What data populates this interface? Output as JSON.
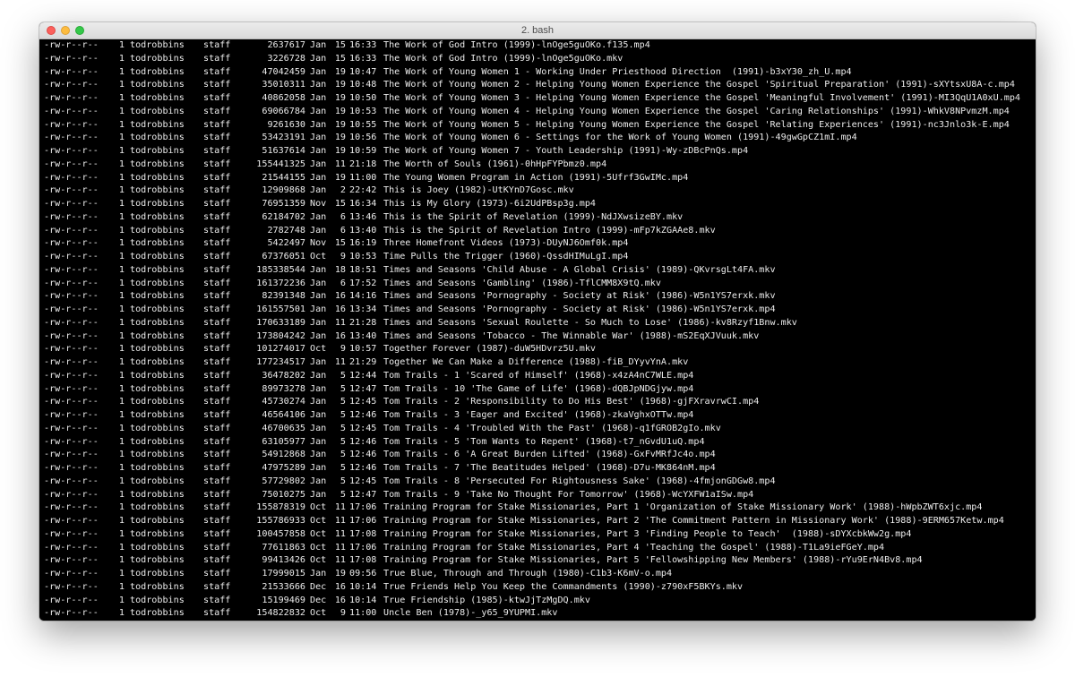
{
  "window": {
    "title": "2. bash"
  },
  "colors": {
    "terminal_bg": "#000000",
    "terminal_fg": "#ececec",
    "close": "#fc605c",
    "minimize": "#fdbc40",
    "maximize": "#34c84a"
  },
  "listing": [
    {
      "perm": "-rw-r--r--",
      "links": "1",
      "owner": "todrobbins",
      "group": "staff",
      "size": "2637617",
      "month": "Jan",
      "day": "15",
      "time": "16:33",
      "name": "The Work of God Intro (1999)-lnOge5guOKo.f135.mp4"
    },
    {
      "perm": "-rw-r--r--",
      "links": "1",
      "owner": "todrobbins",
      "group": "staff",
      "size": "3226728",
      "month": "Jan",
      "day": "15",
      "time": "16:33",
      "name": "The Work of God Intro (1999)-lnOge5guOKo.mkv"
    },
    {
      "perm": "-rw-r--r--",
      "links": "1",
      "owner": "todrobbins",
      "group": "staff",
      "size": "47042459",
      "month": "Jan",
      "day": "19",
      "time": "10:47",
      "name": "The Work of Young Women 1 - Working Under Priesthood Direction  (1991)-b3xY30_zh_U.mp4"
    },
    {
      "perm": "-rw-r--r--",
      "links": "1",
      "owner": "todrobbins",
      "group": "staff",
      "size": "35010311",
      "month": "Jan",
      "day": "19",
      "time": "10:48",
      "name": "The Work of Young Women 2 - Helping Young Women Experience the Gospel 'Spiritual Preparation' (1991)-sXYtsxU8A-c.mp4"
    },
    {
      "perm": "-rw-r--r--",
      "links": "1",
      "owner": "todrobbins",
      "group": "staff",
      "size": "40862058",
      "month": "Jan",
      "day": "19",
      "time": "10:50",
      "name": "The Work of Young Women 3 - Helping Young Women Experience the Gospel 'Meaningful Involvement' (1991)-MI3QqU1A0xU.mp4"
    },
    {
      "perm": "-rw-r--r--",
      "links": "1",
      "owner": "todrobbins",
      "group": "staff",
      "size": "69066784",
      "month": "Jan",
      "day": "19",
      "time": "10:53",
      "name": "The Work of Young Women 4 - Helping Young Women Experience the Gospel 'Caring Relationships' (1991)-WhkV8NPvmzM.mp4"
    },
    {
      "perm": "-rw-r--r--",
      "links": "1",
      "owner": "todrobbins",
      "group": "staff",
      "size": "9261630",
      "month": "Jan",
      "day": "19",
      "time": "10:55",
      "name": "The Work of Young Women 5 - Helping Young Women Experience the Gospel 'Relating Experiences' (1991)-nc3Jnlo3k-E.mp4"
    },
    {
      "perm": "-rw-r--r--",
      "links": "1",
      "owner": "todrobbins",
      "group": "staff",
      "size": "53423191",
      "month": "Jan",
      "day": "19",
      "time": "10:56",
      "name": "The Work of Young Women 6 - Settings for the Work of Young Women (1991)-49gwGpCZ1mI.mp4"
    },
    {
      "perm": "-rw-r--r--",
      "links": "1",
      "owner": "todrobbins",
      "group": "staff",
      "size": "51637614",
      "month": "Jan",
      "day": "19",
      "time": "10:59",
      "name": "The Work of Young Women 7 - Youth Leadership (1991)-Wy-zDBcPnQs.mp4"
    },
    {
      "perm": "-rw-r--r--",
      "links": "1",
      "owner": "todrobbins",
      "group": "staff",
      "size": "155441325",
      "month": "Jan",
      "day": "11",
      "time": "21:18",
      "name": "The Worth of Souls (1961)-0hHpFYPbmz0.mp4"
    },
    {
      "perm": "-rw-r--r--",
      "links": "1",
      "owner": "todrobbins",
      "group": "staff",
      "size": "21544155",
      "month": "Jan",
      "day": "19",
      "time": "11:00",
      "name": "The Young Women Program in Action (1991)-5Ufrf3GwIMc.mp4"
    },
    {
      "perm": "-rw-r--r--",
      "links": "1",
      "owner": "todrobbins",
      "group": "staff",
      "size": "12909868",
      "month": "Jan",
      "day": "2",
      "time": "22:42",
      "name": "This is Joey (1982)-UtKYnD7Gosc.mkv"
    },
    {
      "perm": "-rw-r--r--",
      "links": "1",
      "owner": "todrobbins",
      "group": "staff",
      "size": "76951359",
      "month": "Nov",
      "day": "15",
      "time": "16:34",
      "name": "This is My Glory (1973)-6i2UdPBsp3g.mp4"
    },
    {
      "perm": "-rw-r--r--",
      "links": "1",
      "owner": "todrobbins",
      "group": "staff",
      "size": "62184702",
      "month": "Jan",
      "day": "6",
      "time": "13:46",
      "name": "This is the Spirit of Revelation (1999)-NdJXwsizeBY.mkv"
    },
    {
      "perm": "-rw-r--r--",
      "links": "1",
      "owner": "todrobbins",
      "group": "staff",
      "size": "2782748",
      "month": "Jan",
      "day": "6",
      "time": "13:40",
      "name": "This is the Spirit of Revelation Intro (1999)-mFp7kZGAAe8.mkv"
    },
    {
      "perm": "-rw-r--r--",
      "links": "1",
      "owner": "todrobbins",
      "group": "staff",
      "size": "5422497",
      "month": "Nov",
      "day": "15",
      "time": "16:19",
      "name": "Three Homefront Videos (1973)-DUyNJ6Omf0k.mp4"
    },
    {
      "perm": "-rw-r--r--",
      "links": "1",
      "owner": "todrobbins",
      "group": "staff",
      "size": "67376051",
      "month": "Oct",
      "day": "9",
      "time": "10:53",
      "name": "Time Pulls the Trigger (1960)-QssdHIMuLgI.mp4"
    },
    {
      "perm": "-rw-r--r--",
      "links": "1",
      "owner": "todrobbins",
      "group": "staff",
      "size": "185338544",
      "month": "Jan",
      "day": "18",
      "time": "18:51",
      "name": "Times and Seasons 'Child Abuse - A Global Crisis' (1989)-QKvrsgLt4FA.mkv"
    },
    {
      "perm": "-rw-r--r--",
      "links": "1",
      "owner": "todrobbins",
      "group": "staff",
      "size": "161372236",
      "month": "Jan",
      "day": "6",
      "time": "17:52",
      "name": "Times and Seasons 'Gambling' (1986)-TflCMM8X9tQ.mkv"
    },
    {
      "perm": "-rw-r--r--",
      "links": "1",
      "owner": "todrobbins",
      "group": "staff",
      "size": "82391348",
      "month": "Jan",
      "day": "16",
      "time": "14:16",
      "name": "Times and Seasons 'Pornography - Society at Risk' (1986)-W5n1YS7erxk.mkv"
    },
    {
      "perm": "-rw-r--r--",
      "links": "1",
      "owner": "todrobbins",
      "group": "staff",
      "size": "161557501",
      "month": "Jan",
      "day": "16",
      "time": "13:34",
      "name": "Times and Seasons 'Pornography - Society at Risk' (1986)-W5n1YS7erxk.mp4"
    },
    {
      "perm": "-rw-r--r--",
      "links": "1",
      "owner": "todrobbins",
      "group": "staff",
      "size": "170633189",
      "month": "Jan",
      "day": "11",
      "time": "21:28",
      "name": "Times and Seasons 'Sexual Roulette - So Much to Lose' (1986)-kv8Rzyf1Bnw.mkv"
    },
    {
      "perm": "-rw-r--r--",
      "links": "1",
      "owner": "todrobbins",
      "group": "staff",
      "size": "173804242",
      "month": "Jan",
      "day": "16",
      "time": "13:40",
      "name": "Times and Seasons 'Tobacco - The Winnable War' (1988)-mS2EqXJVuuk.mkv"
    },
    {
      "perm": "-rw-r--r--",
      "links": "1",
      "owner": "todrobbins",
      "group": "staff",
      "size": "101274017",
      "month": "Oct",
      "day": "9",
      "time": "10:57",
      "name": "Together Forever (1987)-duW5HDvrz5U.mkv"
    },
    {
      "perm": "-rw-r--r--",
      "links": "1",
      "owner": "todrobbins",
      "group": "staff",
      "size": "177234517",
      "month": "Jan",
      "day": "11",
      "time": "21:29",
      "name": "Together We Can Make a Difference (1988)-fiB_DYyvYnA.mkv"
    },
    {
      "perm": "-rw-r--r--",
      "links": "1",
      "owner": "todrobbins",
      "group": "staff",
      "size": "36478202",
      "month": "Jan",
      "day": "5",
      "time": "12:44",
      "name": "Tom Trails - 1 'Scared of Himself' (1968)-x4zA4nC7WLE.mp4"
    },
    {
      "perm": "-rw-r--r--",
      "links": "1",
      "owner": "todrobbins",
      "group": "staff",
      "size": "89973278",
      "month": "Jan",
      "day": "5",
      "time": "12:47",
      "name": "Tom Trails - 10 'The Game of Life' (1968)-dQBJpNDGjyw.mp4"
    },
    {
      "perm": "-rw-r--r--",
      "links": "1",
      "owner": "todrobbins",
      "group": "staff",
      "size": "45730274",
      "month": "Jan",
      "day": "5",
      "time": "12:45",
      "name": "Tom Trails - 2 'Responsibility to Do His Best' (1968)-gjFXravrwCI.mp4"
    },
    {
      "perm": "-rw-r--r--",
      "links": "1",
      "owner": "todrobbins",
      "group": "staff",
      "size": "46564106",
      "month": "Jan",
      "day": "5",
      "time": "12:46",
      "name": "Tom Trails - 3 'Eager and Excited' (1968)-zkaVghxOTTw.mp4"
    },
    {
      "perm": "-rw-r--r--",
      "links": "1",
      "owner": "todrobbins",
      "group": "staff",
      "size": "46700635",
      "month": "Jan",
      "day": "5",
      "time": "12:45",
      "name": "Tom Trails - 4 'Troubled With the Past' (1968)-q1fGROB2gIo.mkv"
    },
    {
      "perm": "-rw-r--r--",
      "links": "1",
      "owner": "todrobbins",
      "group": "staff",
      "size": "63105977",
      "month": "Jan",
      "day": "5",
      "time": "12:46",
      "name": "Tom Trails - 5 'Tom Wants to Repent' (1968)-t7_nGvdU1uQ.mp4"
    },
    {
      "perm": "-rw-r--r--",
      "links": "1",
      "owner": "todrobbins",
      "group": "staff",
      "size": "54912868",
      "month": "Jan",
      "day": "5",
      "time": "12:46",
      "name": "Tom Trails - 6 'A Great Burden Lifted' (1968)-GxFvMRfJc4o.mp4"
    },
    {
      "perm": "-rw-r--r--",
      "links": "1",
      "owner": "todrobbins",
      "group": "staff",
      "size": "47975289",
      "month": "Jan",
      "day": "5",
      "time": "12:46",
      "name": "Tom Trails - 7 'The Beatitudes Helped' (1968)-D7u-MK864nM.mp4"
    },
    {
      "perm": "-rw-r--r--",
      "links": "1",
      "owner": "todrobbins",
      "group": "staff",
      "size": "57729802",
      "month": "Jan",
      "day": "5",
      "time": "12:45",
      "name": "Tom Trails - 8 'Persecuted For Rightousness Sake' (1968)-4fmjonGDGw8.mp4"
    },
    {
      "perm": "-rw-r--r--",
      "links": "1",
      "owner": "todrobbins",
      "group": "staff",
      "size": "75010275",
      "month": "Jan",
      "day": "5",
      "time": "12:47",
      "name": "Tom Trails - 9 'Take No Thought For Tomorrow' (1968)-WcYXFW1aISw.mp4"
    },
    {
      "perm": "-rw-r--r--",
      "links": "1",
      "owner": "todrobbins",
      "group": "staff",
      "size": "155878319",
      "month": "Oct",
      "day": "11",
      "time": "17:06",
      "name": "Training Program for Stake Missionaries, Part 1 'Organization of Stake Missionary Work' (1988)-hWpbZWT6xjc.mp4"
    },
    {
      "perm": "-rw-r--r--",
      "links": "1",
      "owner": "todrobbins",
      "group": "staff",
      "size": "155786933",
      "month": "Oct",
      "day": "11",
      "time": "17:06",
      "name": "Training Program for Stake Missionaries, Part 2 'The Commitment Pattern in Missionary Work' (1988)-9ERM657Ketw.mp4"
    },
    {
      "perm": "-rw-r--r--",
      "links": "1",
      "owner": "todrobbins",
      "group": "staff",
      "size": "100457858",
      "month": "Oct",
      "day": "11",
      "time": "17:08",
      "name": "Training Program for Stake Missionaries, Part 3 'Finding People to Teach'  (1988)-sDYXcbkWw2g.mp4"
    },
    {
      "perm": "-rw-r--r--",
      "links": "1",
      "owner": "todrobbins",
      "group": "staff",
      "size": "77611863",
      "month": "Oct",
      "day": "11",
      "time": "17:06",
      "name": "Training Program for Stake Missionaries, Part 4 'Teaching the Gospel' (1988)-T1La9ieFGeY.mp4"
    },
    {
      "perm": "-rw-r--r--",
      "links": "1",
      "owner": "todrobbins",
      "group": "staff",
      "size": "99413426",
      "month": "Oct",
      "day": "11",
      "time": "17:08",
      "name": "Training Program for Stake Missionaries, Part 5 'Fellowshipping New Members' (1988)-rYu9ErN4Bv8.mp4"
    },
    {
      "perm": "-rw-r--r--",
      "links": "1",
      "owner": "todrobbins",
      "group": "staff",
      "size": "17999015",
      "month": "Jan",
      "day": "19",
      "time": "09:56",
      "name": "True Blue, Through and Through (1980)-C1b3-K6mV-o.mp4"
    },
    {
      "perm": "-rw-r--r--",
      "links": "1",
      "owner": "todrobbins",
      "group": "staff",
      "size": "21533666",
      "month": "Dec",
      "day": "16",
      "time": "10:14",
      "name": "True Friends Help You Keep the Commandments (1990)-z790xF5BKYs.mkv"
    },
    {
      "perm": "-rw-r--r--",
      "links": "1",
      "owner": "todrobbins",
      "group": "staff",
      "size": "15199469",
      "month": "Dec",
      "day": "16",
      "time": "10:14",
      "name": "True Friendship (1985)-ktwJjTzMgDQ.mkv"
    },
    {
      "perm": "-rw-r--r--",
      "links": "1",
      "owner": "todrobbins",
      "group": "staff",
      "size": "154822832",
      "month": "Oct",
      "day": "9",
      "time": "11:00",
      "name": "Uncle Ben (1978)-_y65_9YUPMI.mkv"
    }
  ]
}
